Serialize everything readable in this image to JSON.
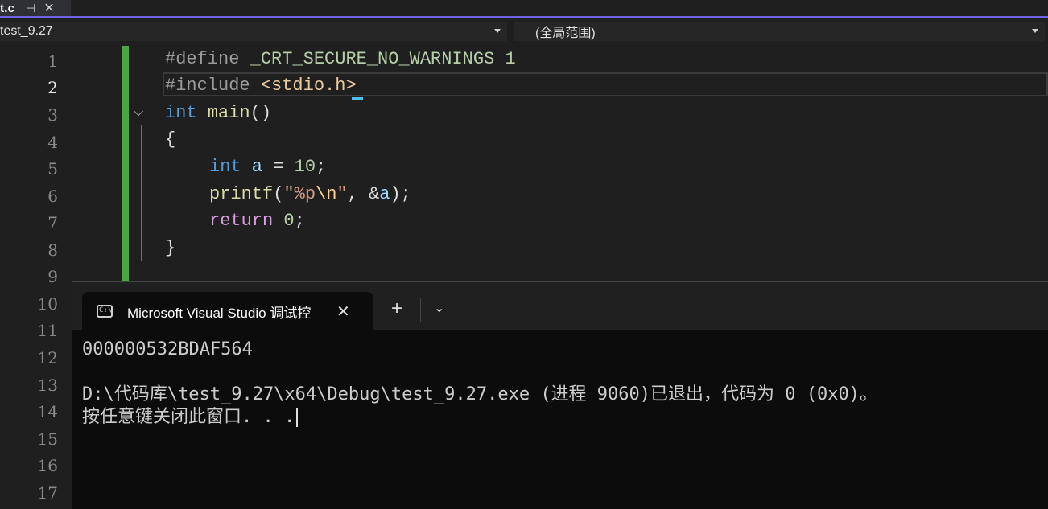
{
  "file_tab": {
    "name": "t.c",
    "pin_icon": "pin-icon",
    "close_icon": "close-icon"
  },
  "nav": {
    "project": "test_9.27",
    "scope": "(全局范围)"
  },
  "editor": {
    "line_numbers": [
      "1",
      "2",
      "3",
      "4",
      "5",
      "6",
      "7",
      "8",
      "9",
      "10",
      "11",
      "12",
      "13",
      "14",
      "15",
      "16",
      "17"
    ],
    "active_line": "2",
    "code": {
      "l1_pp": "#define",
      "l1_macro": " _CRT_SECURE_NO_WARNINGS ",
      "l1_num": "1",
      "l2_pp": "#include",
      "l2_inc": " <stdio.h>",
      "l3_kw": "int",
      "l3_fn": " main",
      "l3_paren": "()",
      "l4": "{",
      "l5_kw": "int",
      "l5_var": " a",
      "l5_op": " = ",
      "l5_num": "10",
      "l5_end": ";",
      "l6_fn": "printf",
      "l6_open": "(",
      "l6_str1": "\"%p",
      "l6_esc": "\\n",
      "l6_str2": "\"",
      "l6_mid": ", &",
      "l6_var": "a",
      "l6_end": ");",
      "l7_kw": "return",
      "l7_sp": " ",
      "l7_num": "0",
      "l7_end": ";",
      "l8": "}"
    }
  },
  "terminal": {
    "tab_title": "Microsoft Visual Studio 调试控",
    "icon": "console-icon",
    "new_tab": "+",
    "menu": "⌄",
    "output": [
      "000000532BDAF564",
      "",
      "D:\\代码库\\test_9.27\\x64\\Debug\\test_9.27.exe (进程 9060)已退出，代码为 0 (0x0)。",
      "按任意键关闭此窗口. . ."
    ]
  }
}
